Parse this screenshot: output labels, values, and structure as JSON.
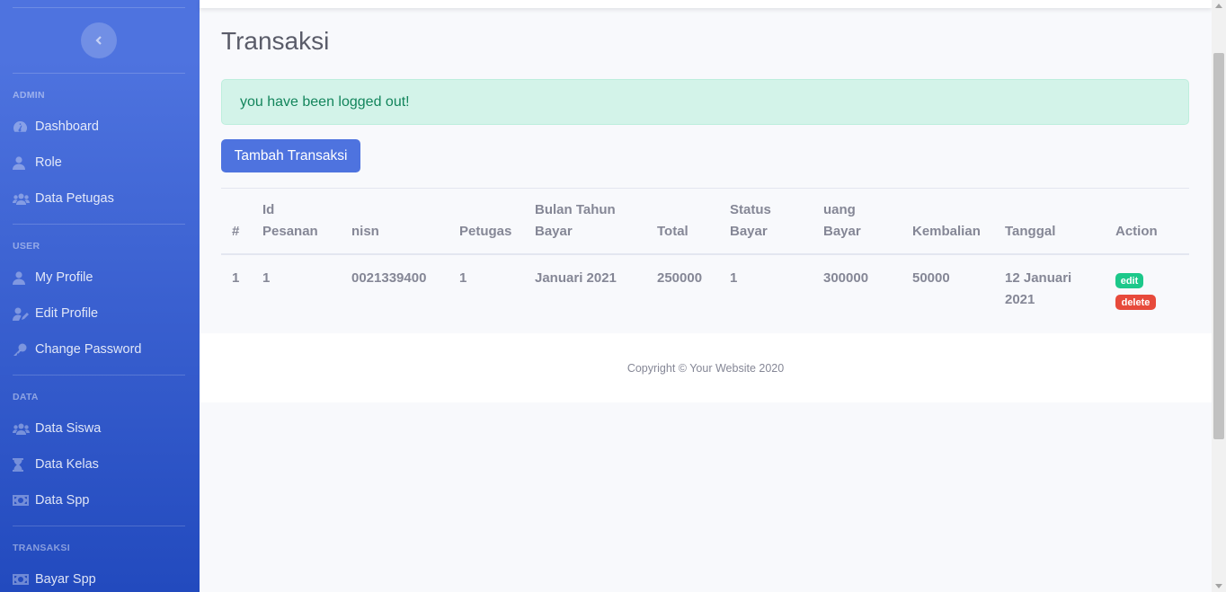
{
  "sidebar": {
    "toggle_icon": "chevron-left-icon",
    "sections": [
      {
        "heading": "Admin",
        "items": [
          {
            "label": "Dashboard",
            "icon": "tachometer-icon"
          },
          {
            "label": "Role",
            "icon": "user-icon"
          },
          {
            "label": "Data Petugas",
            "icon": "users-icon"
          }
        ]
      },
      {
        "heading": "User",
        "items": [
          {
            "label": "My Profile",
            "icon": "user-icon"
          },
          {
            "label": "Edit Profile",
            "icon": "user-edit-icon"
          },
          {
            "label": "Change Password",
            "icon": "key-icon"
          }
        ]
      },
      {
        "heading": "Data",
        "items": [
          {
            "label": "Data Siswa",
            "icon": "users-icon"
          },
          {
            "label": "Data Kelas",
            "icon": "hourglass-icon"
          },
          {
            "label": "Data Spp",
            "icon": "money-bill-icon"
          }
        ]
      },
      {
        "heading": "Transaksi",
        "items": [
          {
            "label": "Bayar Spp",
            "icon": "money-bill-icon"
          }
        ]
      }
    ]
  },
  "main": {
    "title": "Transaksi",
    "alert": "you have been logged out!",
    "add_button": "Tambah Transaksi",
    "table": {
      "headers": [
        [
          "#"
        ],
        [
          "Id",
          "Pesanan"
        ],
        [
          "nisn"
        ],
        [
          "Petugas"
        ],
        [
          "Bulan Tahun",
          "Bayar"
        ],
        [
          "Total"
        ],
        [
          "Status",
          "Bayar"
        ],
        [
          "uang",
          "Bayar"
        ],
        [
          "Kembalian"
        ],
        [
          "Tanggal"
        ],
        [
          "Action"
        ]
      ],
      "rows": [
        {
          "no": "1",
          "id_pesanan": "1",
          "nisn": "0021339400",
          "petugas": "1",
          "bulan_tahun": "Januari 2021",
          "total": "250000",
          "status": "1",
          "uang_bayar": "300000",
          "kembalian": "50000",
          "tanggal": [
            "12 Januari",
            "2021"
          ],
          "actions": {
            "edit": "edit",
            "delete": "delete"
          }
        }
      ]
    }
  },
  "footer": {
    "text": "Copyright © Your Website 2020"
  },
  "colors": {
    "primary": "#4e73df",
    "success": "#1cc88a",
    "danger": "#e74a3b",
    "alert_bg": "#d3f3e9"
  }
}
